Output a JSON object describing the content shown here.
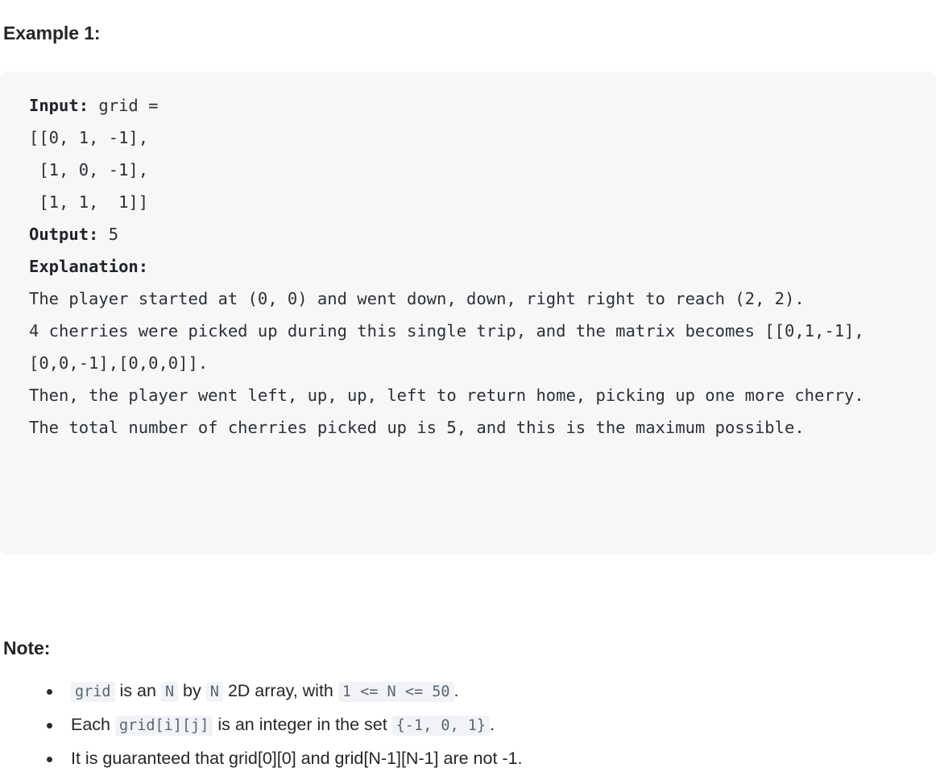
{
  "example": {
    "heading": "Example 1:",
    "input_label": "Input:",
    "input_value": " grid =",
    "grid_rows": [
      "[[0, 1, -1],",
      " [1, 0, -1],",
      " [1, 1,  1]]"
    ],
    "output_label": "Output:",
    "output_value": " 5",
    "explanation_label": "Explanation:",
    "explanation_lines": [
      "The player started at (0, 0) and went down, down, right right to reach (2, 2).",
      "4 cherries were picked up during this single trip, and the matrix becomes [[0,1,-1],[0,0,-1],[0,0,0]].",
      "Then, the player went left, up, up, left to return home, picking up one more cherry.",
      "The total number of cherries picked up is 5, and this is the maximum possible."
    ]
  },
  "note": {
    "heading": "Note:",
    "items": [
      {
        "parts": [
          {
            "type": "code",
            "text": "grid"
          },
          {
            "type": "text",
            "text": " is an "
          },
          {
            "type": "code",
            "text": "N"
          },
          {
            "type": "text",
            "text": " by "
          },
          {
            "type": "code",
            "text": "N"
          },
          {
            "type": "text",
            "text": " 2D array, with "
          },
          {
            "type": "code",
            "text": "1 <= N <= 50"
          },
          {
            "type": "text",
            "text": "."
          }
        ]
      },
      {
        "parts": [
          {
            "type": "text",
            "text": "Each "
          },
          {
            "type": "code",
            "text": "grid[i][j]"
          },
          {
            "type": "text",
            "text": " is an integer in the set "
          },
          {
            "type": "code",
            "text": "{-1, 0, 1}"
          },
          {
            "type": "text",
            "text": "."
          }
        ]
      },
      {
        "parts": [
          {
            "type": "text",
            "text": "It is guaranteed that grid[0][0] and grid[N-1][N-1] are not -1."
          }
        ]
      }
    ]
  },
  "colors": {
    "code_block_bg": "#f7f7f8",
    "inline_code_bg": "#f1f3f6",
    "inline_code_fg": "#5b6673",
    "body_fg": "#262626"
  }
}
